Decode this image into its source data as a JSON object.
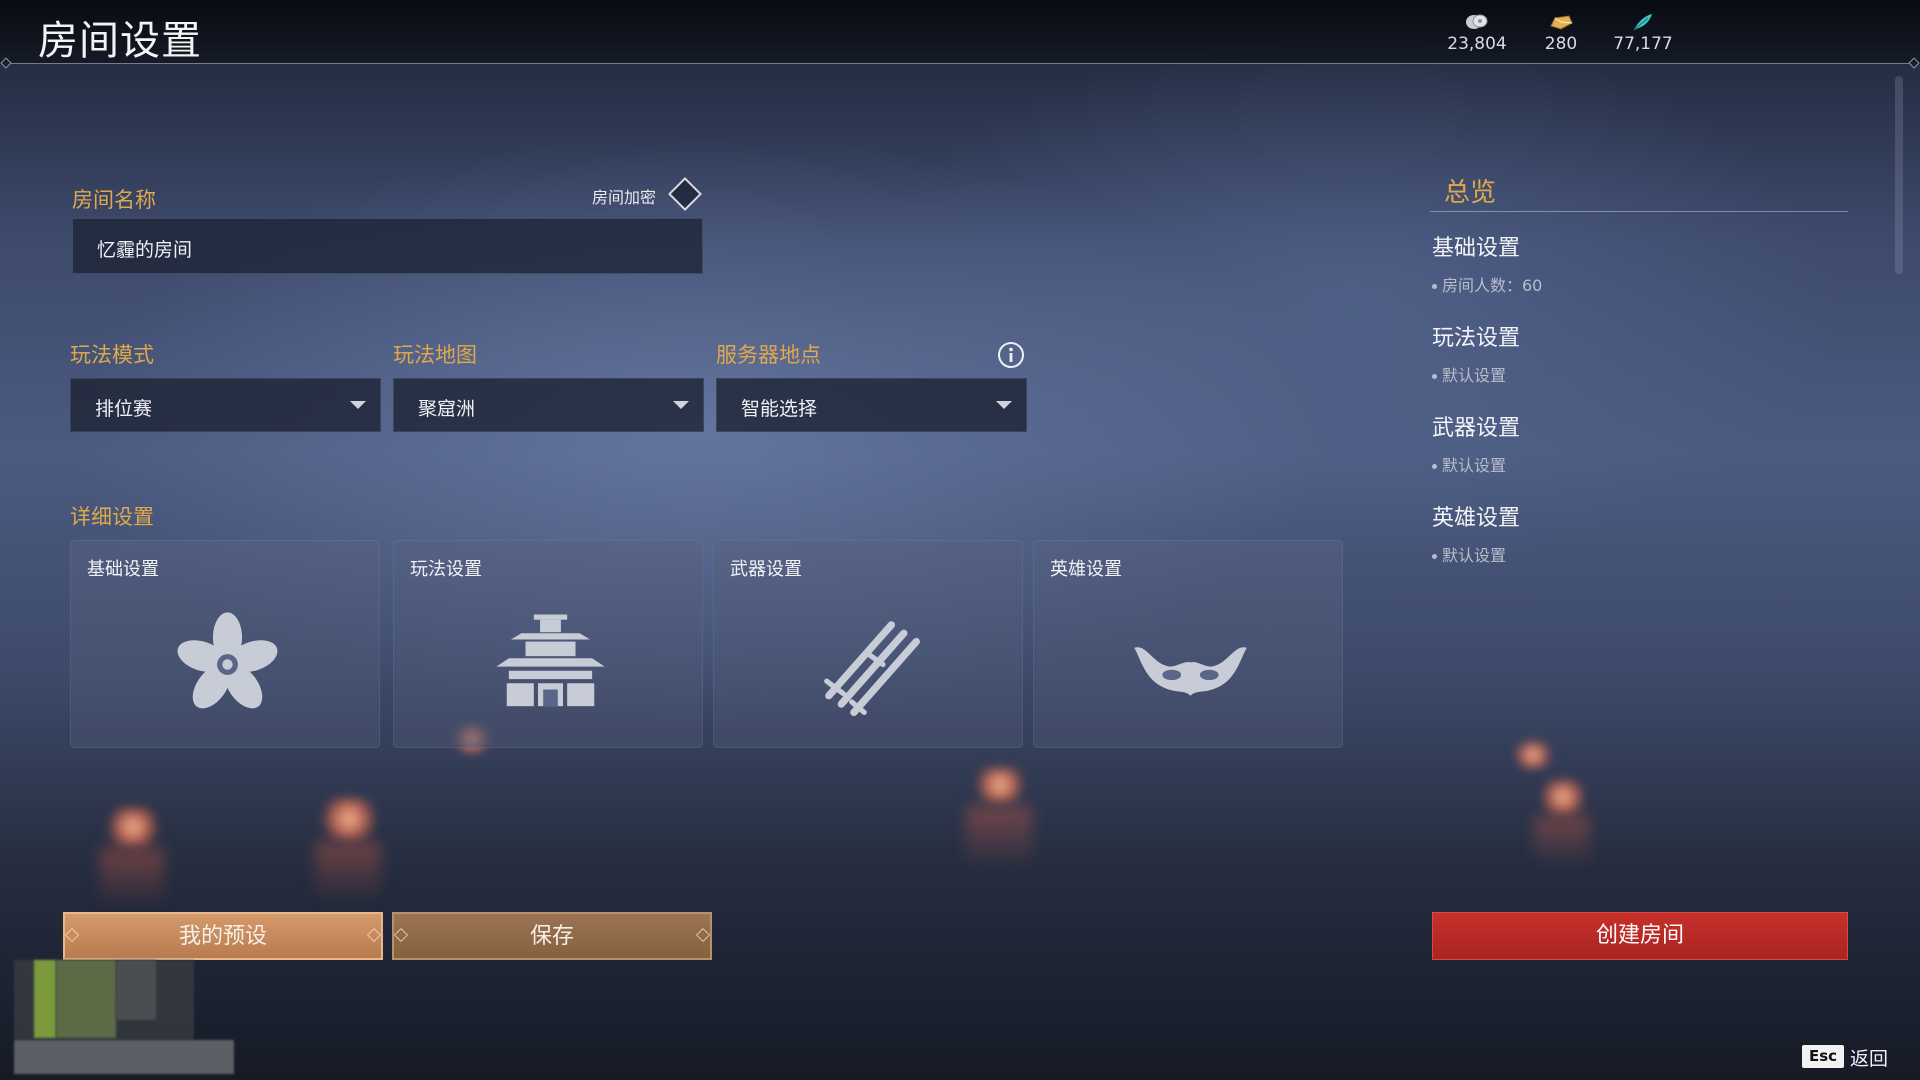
{
  "header": {
    "title": "房间设置",
    "currencies": [
      {
        "icon": "coin-icon",
        "value": "23,804"
      },
      {
        "icon": "gold-ingot-icon",
        "value": "280"
      },
      {
        "icon": "feather-icon",
        "value": "77,177"
      }
    ]
  },
  "room": {
    "name_label": "房间名称",
    "name_value": "忆霾的房间",
    "encrypt_label": "房间加密",
    "encrypt_checked": false
  },
  "selects": {
    "mode": {
      "label": "玩法模式",
      "value": "排位赛"
    },
    "map": {
      "label": "玩法地图",
      "value": "聚窟洲"
    },
    "server": {
      "label": "服务器地点",
      "value": "智能选择"
    }
  },
  "details": {
    "label": "详细设置",
    "cards": [
      {
        "title": "基础设置",
        "icon": "flower-icon"
      },
      {
        "title": "玩法设置",
        "icon": "pagoda-icon"
      },
      {
        "title": "武器设置",
        "icon": "swords-icon"
      },
      {
        "title": "英雄设置",
        "icon": "mask-icon"
      }
    ]
  },
  "overview": {
    "title": "总览",
    "sections": [
      {
        "heading": "基础设置",
        "item": "房间人数：60"
      },
      {
        "heading": "玩法设置",
        "item": "默认设置"
      },
      {
        "heading": "武器设置",
        "item": "默认设置"
      },
      {
        "heading": "英雄设置",
        "item": "默认设置"
      }
    ]
  },
  "buttons": {
    "preset": "我的预设",
    "save": "保存",
    "create": "创建房间"
  },
  "footer": {
    "esc_key": "Esc",
    "back": "返回"
  },
  "colors": {
    "accent_gold": "#e0a84c",
    "create_red": "#c8302c",
    "preset_orange": "#d59a6b"
  }
}
